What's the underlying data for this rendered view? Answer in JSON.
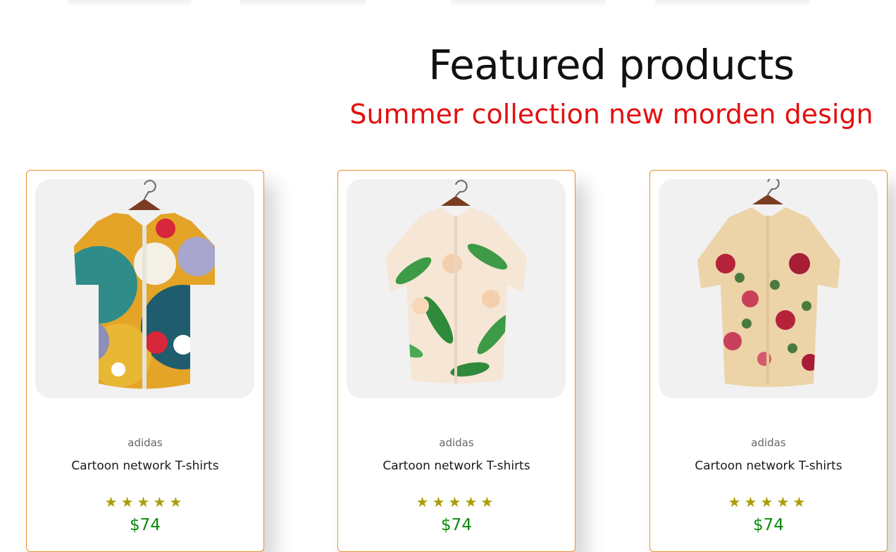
{
  "section": {
    "title": "Featured products",
    "subtitle": "Summer collection new morden design"
  },
  "colors": {
    "subtitle": "#e31010",
    "card_border": "#e8912f",
    "star": "#ad9d07",
    "price": "#0a8a0a"
  },
  "products": [
    {
      "brand": "adidas",
      "name": "Cartoon network T-shirts",
      "rating": 5,
      "rating_display": "★★★★★",
      "price": "$74",
      "image_icon": "abstract-print-shirt-icon"
    },
    {
      "brand": "adidas",
      "name": "Cartoon network T-shirts",
      "rating": 5,
      "rating_display": "★★★★★",
      "price": "$74",
      "image_icon": "lily-print-shirt-icon"
    },
    {
      "brand": "adidas",
      "name": "Cartoon network T-shirts",
      "rating": 5,
      "rating_display": "★★★★★",
      "price": "$74",
      "image_icon": "rose-print-shirt-icon"
    }
  ]
}
